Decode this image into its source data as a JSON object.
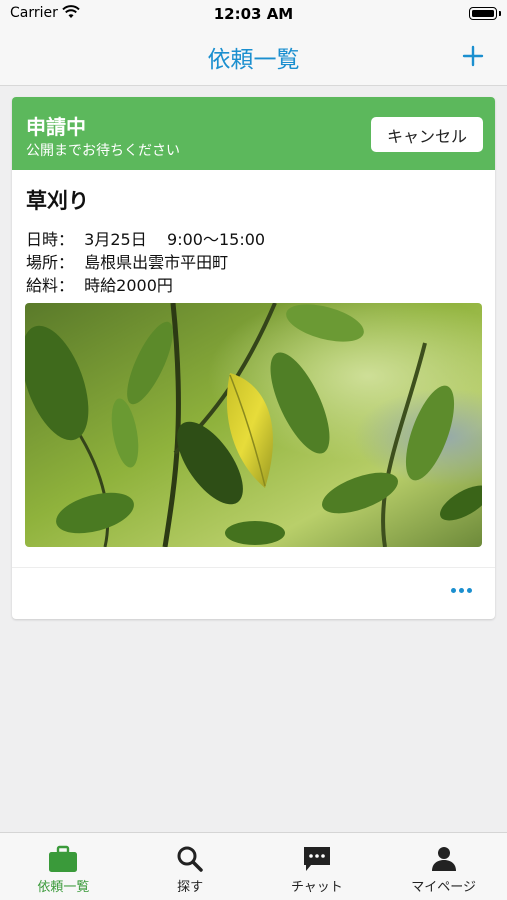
{
  "status_bar": {
    "carrier": "Carrier",
    "time": "12:03 AM"
  },
  "nav": {
    "title": "依頼一覧",
    "add_icon": "plus-icon"
  },
  "card": {
    "status_title": "申請中",
    "status_subtitle": "公開までお待ちください",
    "cancel_label": "キャンセル",
    "job_title": "草刈り",
    "date_line": "日時：  3月25日    9:00～15:00",
    "place_line": "場所：  島根県出雲市平田町",
    "wage_line": "給料：  時給2000円",
    "more_icon": "ellipsis-icon"
  },
  "tabs": [
    {
      "label": "依頼一覧",
      "icon": "briefcase-icon",
      "active": true
    },
    {
      "label": "探す",
      "icon": "search-icon",
      "active": false
    },
    {
      "label": "チャット",
      "icon": "chat-icon",
      "active": false
    },
    {
      "label": "マイページ",
      "icon": "person-icon",
      "active": false
    }
  ],
  "colors": {
    "accent": "#1b8fcf",
    "status_green": "#5cb85c",
    "active_tab": "#3a9a3a"
  }
}
